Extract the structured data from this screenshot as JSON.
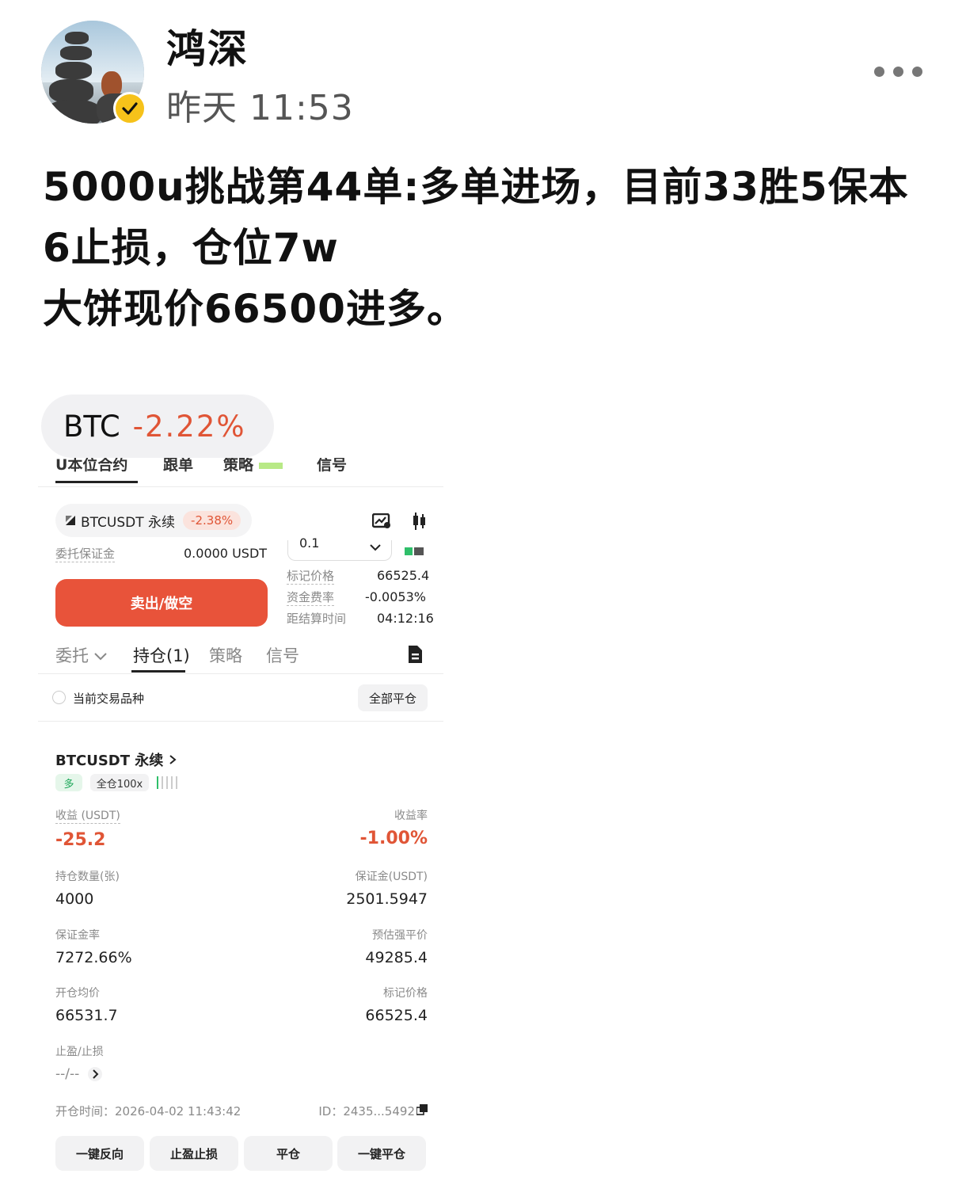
{
  "header": {
    "author_name": "鸿深",
    "post_time": "昨天 11:53",
    "more_icon": "more-horizontal-icon",
    "verified_icon": "verified-check-icon"
  },
  "post": {
    "text": "5000u挑战第44单:多单进场，目前33胜5保本6止损，仓位7w\n大饼现价66500进多。"
  },
  "ticker": {
    "symbol": "BTC",
    "change": "-2.22%",
    "change_color": "#e05536"
  },
  "screenshot": {
    "top_tabs": [
      "U本位合约",
      "跟单",
      "策略",
      "信号"
    ],
    "pair": {
      "name": "BTCUSDT 永续",
      "change": "-2.38%"
    },
    "order_margin_label": "委托保证金",
    "order_margin_value": "0.0000 USDT",
    "qty_value": "0.1",
    "mark_price_label": "标记价格",
    "mark_price_value": "66525.4",
    "funding_rate_label": "资金费率",
    "funding_rate_value": "-0.0053%",
    "settle_label": "距结算时间",
    "settle_value": "04:12:16",
    "sell_button": "卖出/做空",
    "sub_tabs": [
      "委托",
      "持仓(1)",
      "策略",
      "信号"
    ],
    "current_symbol_label": "当前交易品种",
    "close_all_button": "全部平仓",
    "position": {
      "title": "BTCUSDT 永续",
      "side_tag": "多",
      "leverage_tag": "全仓100x",
      "pnl_label": "收益 (USDT)",
      "pnl_value": "-25.2",
      "roe_label": "收益率",
      "roe_value": "-1.00%",
      "size_label": "持仓数量(张)",
      "size_value": "4000",
      "margin_label": "保证金(USDT)",
      "margin_value": "2501.5947",
      "margin_ratio_label": "保证金率",
      "margin_ratio_value": "7272.66%",
      "liq_label": "预估强平价",
      "liq_value": "49285.4",
      "entry_label": "开仓均价",
      "entry_value": "66531.7",
      "mark_label": "标记价格",
      "mark_value": "66525.4",
      "tpsl_label": "止盈/止损",
      "tpsl_value": "--/--",
      "open_time": "开仓时间：2026-04-02 11:43:42",
      "id_text": "ID：2435...5492"
    },
    "footer_buttons": [
      "一键反向",
      "止盈止损",
      "平仓",
      "一键平仓"
    ],
    "colors": {
      "sell": "#e8533a",
      "negative": "#e05536",
      "long": "#1fa85b"
    }
  }
}
